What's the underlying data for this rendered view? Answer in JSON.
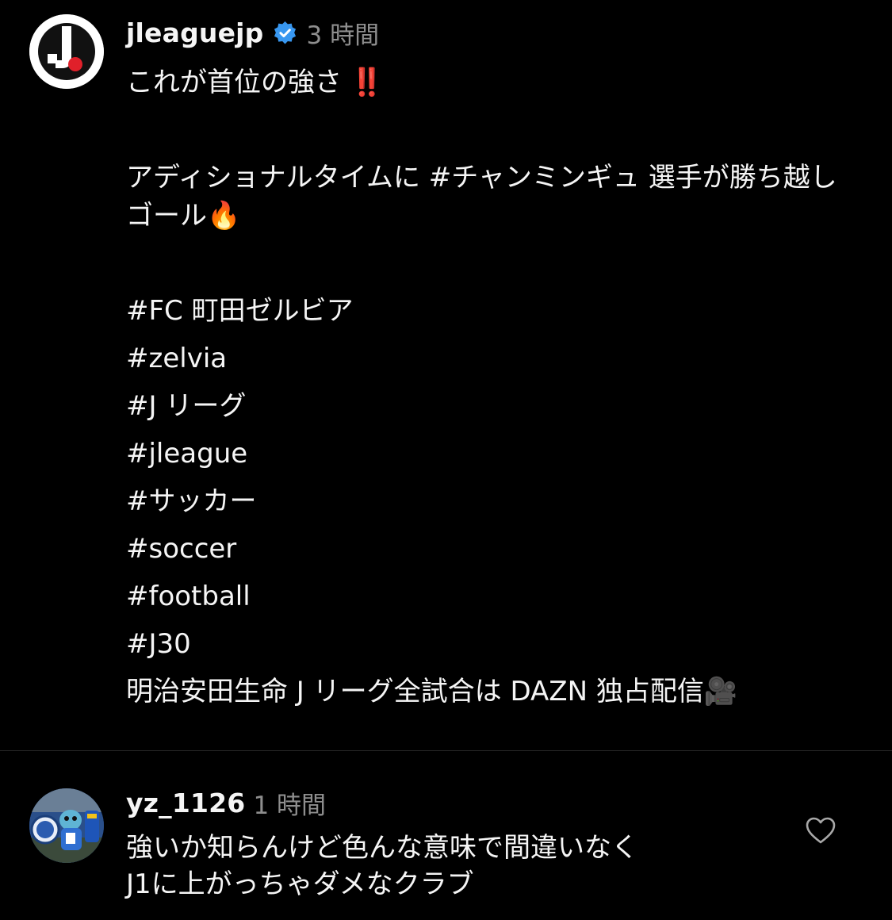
{
  "post": {
    "username": "jleaguejp",
    "verified": true,
    "timestamp": "3 時間",
    "caption_line1": "これが首位の強さ",
    "caption_line1_emoji": "‼️",
    "caption_line2": "アディショナルタイムに #チャンミンギュ 選手が勝ち越しゴール",
    "caption_line2_emoji": "🔥",
    "hashtags": [
      "#FC 町田ゼルビア",
      "#zelvia",
      "#J リーグ",
      "#jleague",
      "#サッカー",
      "#soccer",
      "#football",
      "#J30"
    ],
    "caption_footer": "明治安田生命 J リーグ全試合は DAZN 独占配信",
    "caption_footer_emoji": "🎥"
  },
  "comment": {
    "username": "yz_1126",
    "timestamp": "1 時間",
    "text_lines": [
      "強いか知らんけど色んな意味で間違いなく",
      "J1に上がっちゃダメなクラブ"
    ]
  },
  "icons": {
    "post_avatar": "jleague-logo-icon",
    "comment_avatar": "mascot-photo-avatar",
    "verified": "verified-badge-icon",
    "like": "heart-outline-icon"
  },
  "colors": {
    "background": "#000000",
    "text": "#f5f5f5",
    "muted": "#8e8e8e",
    "verified": "#3897f0",
    "jleague_red": "#e0202a"
  }
}
